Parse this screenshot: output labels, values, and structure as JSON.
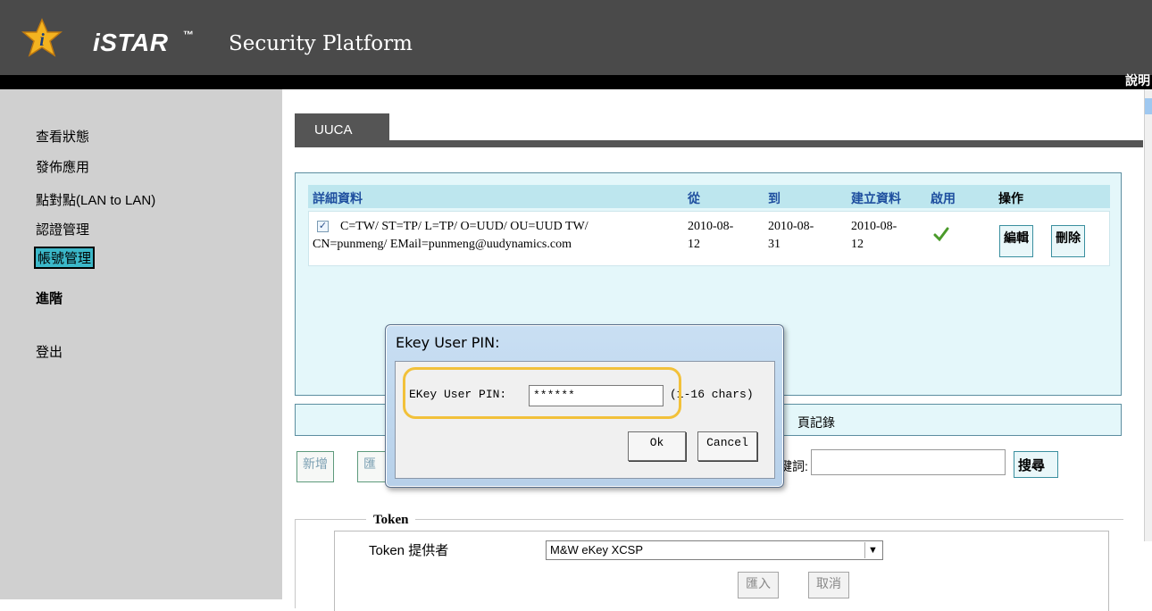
{
  "header": {
    "brand": "iSTAR",
    "trademark": "™",
    "subtitle": "Security Platform",
    "help_link": "說明"
  },
  "sidebar": {
    "items": [
      {
        "label": "查看狀態"
      },
      {
        "label": "發佈應用"
      },
      {
        "label": "點對點(LAN to LAN)"
      },
      {
        "label": "認證管理"
      },
      {
        "label": "帳號管理",
        "selected": true
      },
      {
        "label": "進階"
      },
      {
        "label": "登出"
      }
    ]
  },
  "tab": {
    "label": "UUCA"
  },
  "grid": {
    "columns": [
      "詳細資料",
      "從",
      "到",
      "建立資料",
      "啟用",
      "操作"
    ],
    "rows": [
      {
        "checked": true,
        "details_line1": "C=TW/ ST=TP/ L=TP/ O=UUD/ OU=UUD TW/",
        "details_line2": "CN=punmeng/ EMail=punmeng@uudynamics.com",
        "from_line1": "2010-08-",
        "from_line2": "12",
        "to_line1": "2010-08-",
        "to_line2": "31",
        "created_line1": "2010-08-",
        "created_line2": "12",
        "enabled": true,
        "edit_label": "編輯",
        "delete_label": "刪除"
      }
    ]
  },
  "log_bar": {
    "text": "頁記錄"
  },
  "actions": {
    "add_label": "新增",
    "import_label": "匯",
    "keyword_label": "鍵詞:",
    "keyword_value": "",
    "search_label": "搜尋"
  },
  "token": {
    "legend": "Token",
    "provider_label": "Token 提供者",
    "provider_value": "M&W eKey XCSP",
    "import_label": "匯入",
    "cancel_label": "取消"
  },
  "dialog": {
    "title": "Ekey User PIN:",
    "field_label": "EKey User PIN:",
    "field_value": "******",
    "hint": "(1-16 chars)",
    "ok_label": "Ok",
    "cancel_label": "Cancel"
  },
  "colors": {
    "header_bg": "#4a4a4a",
    "sidebar_bg": "#d0d0d0",
    "selected_nav_bg": "#3bb8c9",
    "grid_header_bg": "#bde6ee",
    "panel_bg": "#e4f7fa",
    "highlight": "#f2c13a",
    "enabled_check": "#4a9a2a"
  }
}
